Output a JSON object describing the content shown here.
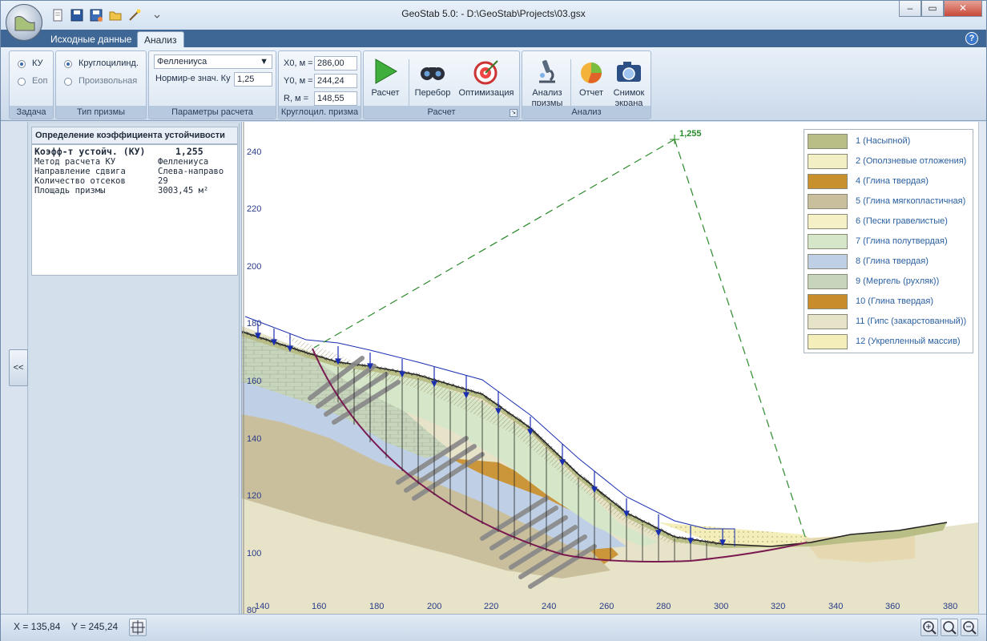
{
  "window": {
    "title": "GeoStab 5.0: - D:\\GeoStab\\Projects\\03.gsx",
    "minimize_icon": "minimize-icon",
    "maximize_icon": "maximize-icon",
    "close_icon": "close-icon"
  },
  "ribbon": {
    "tabs": [
      {
        "label": "Исходные данные",
        "active": false
      },
      {
        "label": "Анализ",
        "active": true
      }
    ],
    "groups": {
      "task": {
        "label": "Задача",
        "options": [
          {
            "label": "КУ",
            "selected": true
          },
          {
            "label": "Eоп",
            "selected": false
          }
        ]
      },
      "prism_type": {
        "label": "Тип призмы",
        "options": [
          {
            "label": "Круглоцилинд.",
            "selected": true
          },
          {
            "label": "Произвольная",
            "selected": false
          }
        ]
      },
      "calc_params": {
        "label": "Параметры расчета",
        "method": "Феллениуса",
        "norm_label": "Нормир-е знач. Ку",
        "norm_value": "1,25"
      },
      "prism": {
        "label": "Круглоцил. призма",
        "x0_label": "X0, м =",
        "x0": "286,00",
        "y0_label": "Y0, м =",
        "y0": "244,24",
        "r_label": "R, м  =",
        "r": "148,55"
      },
      "calc": {
        "label": "Расчет",
        "run": "Расчет",
        "search": "Перебор",
        "optimize": "Оптимизация"
      },
      "analysis": {
        "label": "Анализ",
        "prism_analysis_1": "Анализ",
        "prism_analysis_2": "призмы",
        "report": "Отчет",
        "snapshot_1": "Снимок",
        "snapshot_2": "экрана"
      }
    }
  },
  "left_panel": {
    "collapse_label": "<<"
  },
  "info_panel": {
    "title": "Определение коэффициента устойчивости",
    "header_key": "Коэфф-т устойч. (КУ)",
    "header_value": "1,255",
    "rows": [
      {
        "k": "Метод расчета КУ",
        "v": "Феллениуса"
      },
      {
        "k": "Направление сдвига",
        "v": "Слева-направо"
      },
      {
        "k": "Количество отсеков",
        "v": "29"
      },
      {
        "k": "Площадь призмы",
        "v": "3003,45 м²"
      }
    ]
  },
  "plot": {
    "center_label": "1,255",
    "x_ticks": [
      "140",
      "160",
      "180",
      "200",
      "220",
      "240",
      "260",
      "280",
      "300",
      "320",
      "340",
      "360",
      "380"
    ],
    "y_ticks": [
      "240",
      "220",
      "200",
      "180",
      "160",
      "140",
      "120",
      "100",
      "80"
    ],
    "legend": [
      {
        "label": "1 (Насыпной)",
        "color": "#b9bd86"
      },
      {
        "label": "2 (Оползневые отложения)",
        "color": "#f3efc4"
      },
      {
        "label": "4 (Глина твердая)",
        "color": "#c8912e"
      },
      {
        "label": "5 (Глина мягкопластичная)",
        "color": "#c9bf9c"
      },
      {
        "label": "6 (Пески гравелистые)",
        "color": "#f5f0c6"
      },
      {
        "label": "7 (Глина полутвердая)",
        "color": "#d6e6c9"
      },
      {
        "label": "8 (Глина твердая)",
        "color": "#bfd0e6"
      },
      {
        "label": "9 (Мергель (рухляк))",
        "color": "#c7d5bd"
      },
      {
        "label": "10 (Глина твердая)",
        "color": "#c88d2a"
      },
      {
        "label": "11 (Гипс (закарстованный))",
        "color": "#e6e3c8"
      },
      {
        "label": "12 (Укрепленный массив)",
        "color": "#f4eebb"
      }
    ]
  },
  "status": {
    "x": "X = 135,84",
    "y": "Y = 245,24"
  }
}
